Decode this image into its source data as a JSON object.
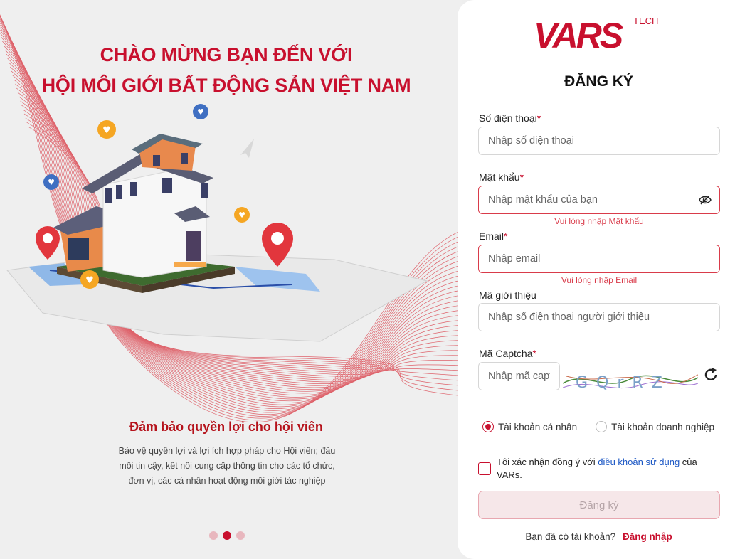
{
  "welcome": {
    "line1": "CHÀO MỪNG BẠN ĐẾN VỚI",
    "line2": "HỘI MÔI GIỚI BẤT ĐỘNG SẢN VIỆT NAM"
  },
  "promo": {
    "title": "Đảm bảo quyền lợi cho hội viên",
    "text": "Bảo vệ quyền lợi và lợi ích hợp pháp cho Hội viên; đầu mối tin cậy, kết nối cung cấp thông tin cho các tổ chức, đơn vị, các cá nhân hoạt động môi giới tác nghiệp"
  },
  "carousel": {
    "count": 3,
    "active": 1
  },
  "brand": {
    "logo_text": "VARS",
    "logo_tech": "TECH",
    "primary_color": "#c8102e"
  },
  "form": {
    "title": "ĐĂNG KÝ",
    "required_mark": "*",
    "phone": {
      "label": "Số điện thoại",
      "placeholder": "Nhập số điện thoại"
    },
    "password": {
      "label": "Mật khẩu",
      "placeholder": "Nhập mật khẩu của bạn",
      "error": "Vui lòng nhập Mật khẩu"
    },
    "email": {
      "label": "Email",
      "placeholder": "Nhập email",
      "error": "Vui lòng nhập Email"
    },
    "referral": {
      "label": "Mã giới thiệu",
      "placeholder": "Nhập số điện thoại người giới thiệu"
    },
    "captcha": {
      "label": "Mã Captcha",
      "placeholder": "Nhập mã captcha",
      "image_text": "GQrRZ"
    },
    "account_type": {
      "options": [
        "Tài khoản cá nhân",
        "Tài khoản doanh nghiệp"
      ],
      "selected": "Tài khoản cá nhân"
    },
    "terms": {
      "prefix": "Tôi xác nhận đồng ý với ",
      "link": "điều khoản sử dụng",
      "suffix": " của VARs.",
      "checked": false
    },
    "submit_label": "Đăng ký",
    "login_prompt": "Bạn đã có tài khoản?",
    "login_link": "Đăng nhập"
  }
}
